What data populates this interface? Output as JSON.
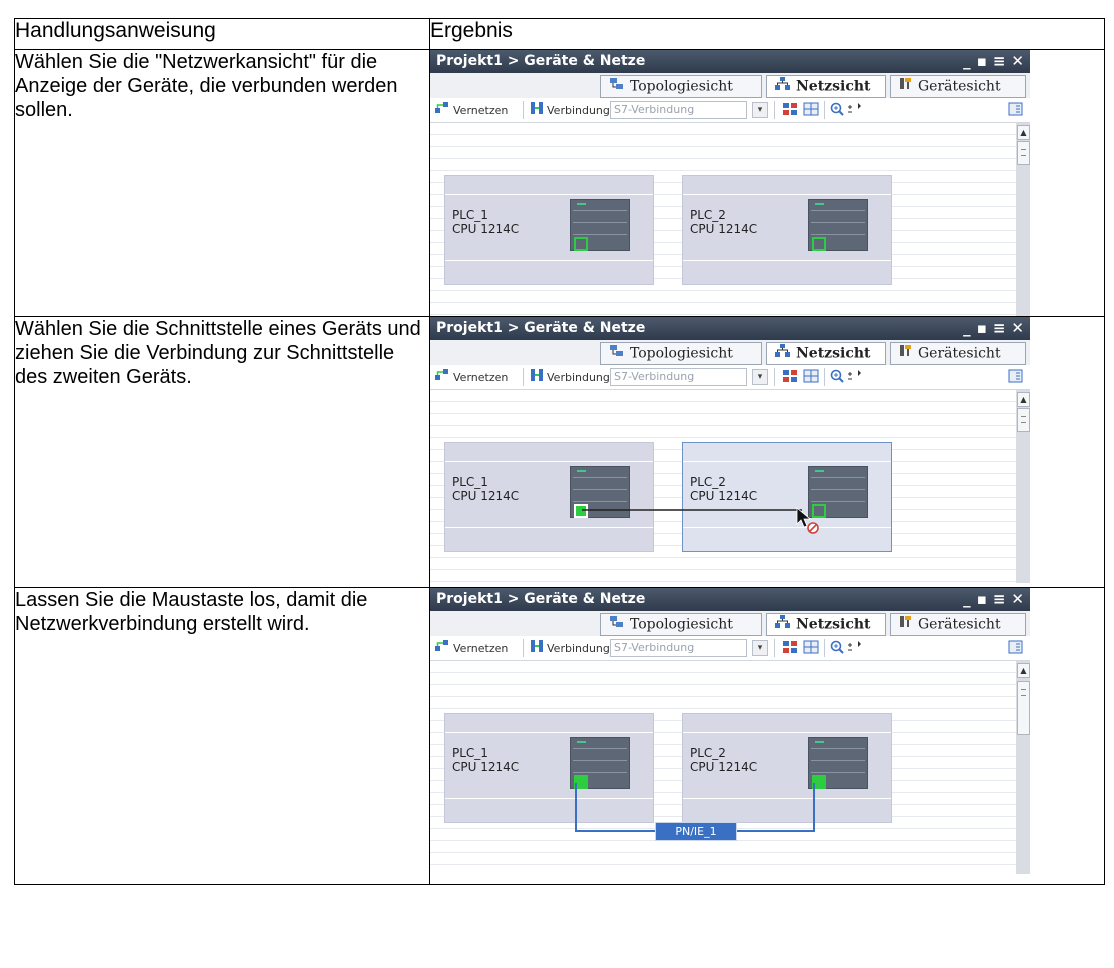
{
  "table": {
    "header_instruction": "Handlungsanweisung",
    "header_result": "Ergebnis",
    "rows": [
      {
        "instruction": "Wählen Sie die \"Netzwerkansicht\" für die Anzeige der Geräte, die verbunden werden sollen."
      },
      {
        "instruction": "Wählen Sie die Schnittstelle eines Geräts und ziehen Sie die Verbindung zur Schnittstelle des zweiten Geräts."
      },
      {
        "instruction": "Lassen Sie die Maustaste los, damit die Netzwerkverbindung erstellt wird."
      }
    ]
  },
  "window": {
    "title": "Projekt1 > Geräte & Netze",
    "controls": {
      "minimize": "_",
      "restore": "▪",
      "tile": "≡",
      "close": "✕"
    },
    "tabs": {
      "topology": "Topologiesicht",
      "network": "Netzsicht",
      "device": "Gerätesicht"
    },
    "toolbar": {
      "network_button": "Vernetzen",
      "connections_button": "Verbindungen",
      "connection_type": "S7-Verbindung"
    },
    "devices": [
      {
        "name": "PLC_1",
        "cpu": "CPU 1214C"
      },
      {
        "name": "PLC_2",
        "cpu": "CPU 1214C"
      }
    ],
    "network_label": "PN/IE_1"
  },
  "colors": {
    "titlebar": "#3b4757",
    "network_line": "#3a70c4",
    "port": "#2ecc40",
    "device_bg": "#d6d8e6"
  }
}
